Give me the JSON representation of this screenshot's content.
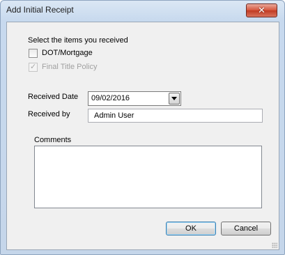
{
  "window": {
    "title": "Add Initial Receipt",
    "close_symbol": "✕"
  },
  "items_prompt": "Select the items you received",
  "items": [
    {
      "label": "DOT/Mortgage",
      "checked": false,
      "enabled": true
    },
    {
      "label": "Final Title Policy",
      "checked": true,
      "enabled": false
    }
  ],
  "received_date": {
    "label": "Received Date",
    "value": "09/02/2016"
  },
  "received_by": {
    "label": "Received by",
    "value": "Admin User"
  },
  "comments": {
    "label": "Comments",
    "value": ""
  },
  "buttons": {
    "ok": "OK",
    "cancel": "Cancel"
  },
  "colors": {
    "close_button": "#c9452d",
    "window_frame": "#c5d6ea",
    "client_bg": "#f0f0f0"
  },
  "icons": {
    "close": "close-icon",
    "dropdown": "chevron-down-icon",
    "check": "check-icon"
  }
}
